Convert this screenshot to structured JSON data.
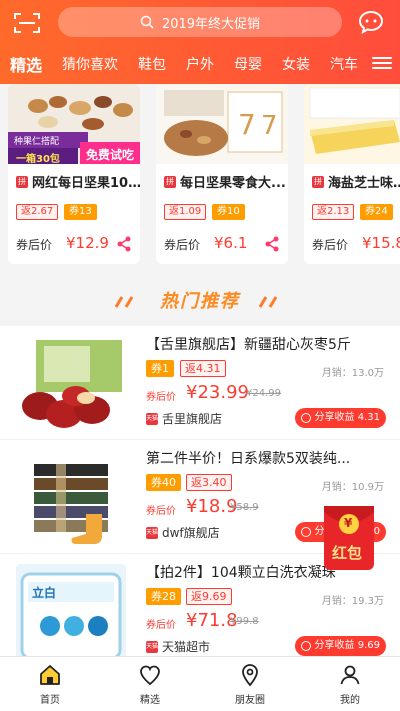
{
  "header": {
    "search_placeholder": "2019年终大促销",
    "categories": [
      "精选",
      "猜你喜欢",
      "鞋包",
      "户外",
      "母婴",
      "女装",
      "汽车"
    ]
  },
  "strip": [
    {
      "platform": "拼",
      "title": "网红每日坚果10...",
      "rebate": "返2.67",
      "coupon": "券13",
      "after_label": "券后价",
      "price": "¥12.9",
      "banner_top": "种果仁搭配",
      "banner_bottom": "一箱30包",
      "banner_free": "免费试吃"
    },
    {
      "platform": "拼",
      "title": "每日坚果零食大...",
      "rebate": "返1.09",
      "coupon": "券10",
      "after_label": "券后价",
      "price": "¥6.1"
    },
    {
      "platform": "拼",
      "title": "海盐芝士味蛋糕",
      "rebate": "返2.13",
      "coupon": "券24",
      "after_label": "券后价",
      "price": "¥15.8"
    }
  ],
  "hot_title": "热门推荐",
  "list": [
    {
      "title": "【舌里旗舰店】新疆甜心灰枣5斤",
      "coupon": "券1",
      "rebate": "返4.31",
      "sales": "月销：13.0万",
      "after_label": "券后价",
      "price": "¥23.99",
      "original": "¥24.99",
      "shop": "舌里旗舰店",
      "shop_icon": "天猫",
      "share": "分享收益 4.31"
    },
    {
      "title": "第二件半价！日系爆款5双装纯...",
      "coupon": "券40",
      "rebate": "返3.40",
      "sales": "月销：10.9万",
      "after_label": "券后价",
      "price": "¥18.9",
      "original": "¥58.9",
      "shop": "dwf旗舰店",
      "shop_icon": "天猫",
      "share": "分享收益 3.40"
    },
    {
      "title": "【拍2件】104颗立白洗衣凝珠",
      "coupon": "券28",
      "rebate": "返9.69",
      "sales": "月销：19.3万",
      "after_label": "券后价",
      "price": "¥71.8",
      "original": "¥99.8",
      "shop": "天猫超市",
      "shop_icon": "天猫",
      "share": "分享收益 9.69"
    }
  ],
  "packet": {
    "symbol": "¥",
    "label": "红包"
  },
  "nav": [
    {
      "label": "首页",
      "icon": "home-icon"
    },
    {
      "label": "精选",
      "icon": "heart-icon"
    },
    {
      "label": "朋友圈",
      "icon": "location-icon"
    },
    {
      "label": "我的",
      "icon": "user-icon"
    }
  ],
  "colors": {
    "brand": "#ff5a35",
    "price": "#ff3b30",
    "coupon": "#ff9d00",
    "hot_title": "#ff8a1f"
  }
}
